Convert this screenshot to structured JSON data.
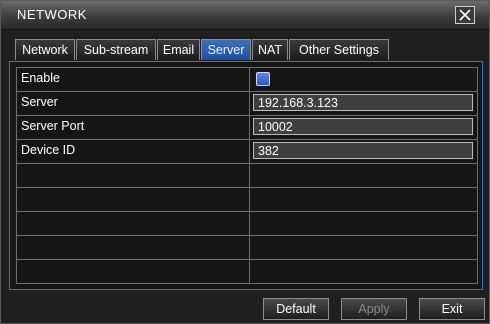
{
  "window": {
    "title": "NETWORK"
  },
  "tabs": [
    {
      "label": "Network",
      "active": false
    },
    {
      "label": "Sub-stream",
      "active": false
    },
    {
      "label": "Email",
      "active": false
    },
    {
      "label": "Server",
      "active": true
    },
    {
      "label": "NAT",
      "active": false
    },
    {
      "label": "Other Settings",
      "active": false
    }
  ],
  "fields": {
    "enable": {
      "label": "Enable",
      "checked": true
    },
    "server": {
      "label": "Server",
      "value": "192.168.3.123"
    },
    "server_port": {
      "label": "Server Port",
      "value": "10002"
    },
    "device_id": {
      "label": "Device ID",
      "value": "382"
    }
  },
  "buttons": {
    "default": "Default",
    "apply": "Apply",
    "exit": "Exit"
  },
  "colors": {
    "accent": "#2f58c0",
    "active_tab": "#3f6fb8",
    "panel_border": "#3f6fd0"
  }
}
